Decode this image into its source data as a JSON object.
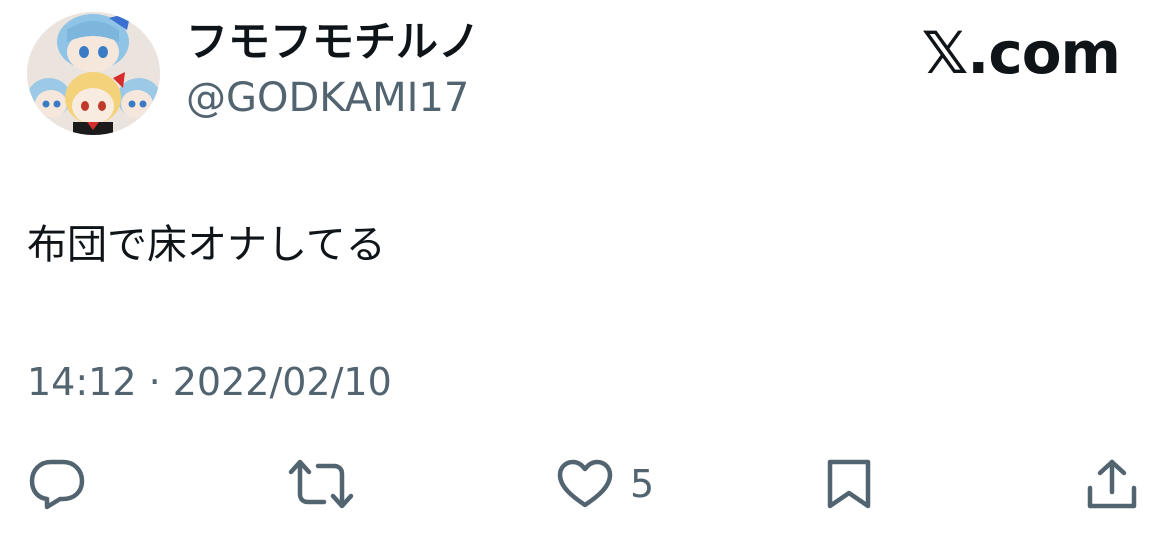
{
  "user": {
    "display_name": "フモフモチルノ",
    "handle": "@GODKAMI17",
    "avatar_icon": "avatar-plush-dolls-icon"
  },
  "brand": {
    "label": "𝕏.com"
  },
  "tweet": {
    "text": "布団で床オナしてる",
    "timestamp": "14:12 · 2022/02/10"
  },
  "actions": {
    "reply_icon": "reply-icon",
    "retweet_icon": "retweet-icon",
    "like_icon": "heart-icon",
    "like_count": "5",
    "bookmark_icon": "bookmark-icon",
    "share_icon": "share-icon"
  },
  "colors": {
    "text_primary": "#0f1419",
    "text_secondary": "#536471",
    "background": "#ffffff"
  }
}
